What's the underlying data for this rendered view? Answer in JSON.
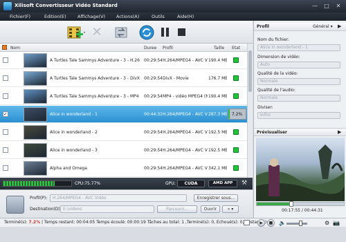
{
  "window": {
    "title": "Xilisoft Convertisseur Vidéo Standard"
  },
  "menu": [
    "Fichier(F)",
    "Edition(E)",
    "Affichage(V)",
    "Actions(A)",
    "Outils",
    "Aide(H)"
  ],
  "list": {
    "headers": {
      "name": "Nom",
      "duration": "Duree",
      "profile": "Profil",
      "size": "Taille",
      "state": "Etat"
    },
    "rows": [
      {
        "name": "A Turtles Tale Sammys Adventure - 3 - H.264...",
        "duration": "00:29:54",
        "profile": "H.264/MPEG4 - AVC Vidéo",
        "size": "190.4 MB",
        "checked": false,
        "selected": false,
        "thumb": "#6f9dc9"
      },
      {
        "name": "A Turtles Tale Sammys Adventure - 3 - DivX ...",
        "duration": "00:29:54",
        "profile": "DivX - Movie",
        "size": "176.7 MB",
        "checked": false,
        "selected": false,
        "thumb": "#79a9d2"
      },
      {
        "name": "A Turtles Tale Sammys Adventure - 3 - MP4 ...",
        "duration": "00:29:54",
        "profile": "MP4 - vidéo MPEG4 (N...",
        "size": "190.4 MB",
        "checked": false,
        "selected": false,
        "thumb": "#5f90bf"
      },
      {
        "name": "Alice in wonderland - 1",
        "duration": "00:44:31",
        "profile": "H.264/MPEG4 - AVC Vid...",
        "size": "287.3 MB",
        "checked": true,
        "selected": true,
        "progress": "7.2%",
        "progress_value": 0.072,
        "thumb": "#3b4d66"
      },
      {
        "name": "Alice in wonderland - 2",
        "duration": "00:29:54",
        "profile": "H.264/MPEG4 - AVC Vid...",
        "size": "192.5 MB",
        "checked": false,
        "selected": false,
        "thumb": "#4b4a3a"
      },
      {
        "name": "Alice in wonderland - 3",
        "duration": "00:29:54",
        "profile": "H.264/MPEG4 - AVC Vid...",
        "size": "192.5 MB",
        "checked": false,
        "selected": false,
        "thumb": "#3f4a3c"
      },
      {
        "name": "Alpha and Omega",
        "duration": "00:29:54",
        "profile": "H.264/MPEG4 - AVC Vid...",
        "size": "342.1 MB",
        "checked": false,
        "selected": false,
        "thumb": "#6b7f95"
      }
    ]
  },
  "cpu": {
    "label": "CPU:75.77%",
    "cpu_fraction": 0.7577,
    "gpu_label": "GPU:",
    "cuda_label": "CUDA",
    "amd_label": "AMD APP"
  },
  "output": {
    "profile_label": "Profil(P):",
    "profile_value": "H.264/MPEG4 - AVC Vidéo",
    "save_as_label": "Enregistrer sous...",
    "destination_label": "Destination(D):",
    "destination_value": "E:\\videos",
    "browse_label": "Parcourir...",
    "open_label": "Ouvrir"
  },
  "status": {
    "prefix": "Terminé(s): ",
    "percent": "7.2%",
    "rest": " | Temps restant: 00:04:05 Temps écoulé: 00:00:19 Tâches au total: 1 ,Terminé(s): 0, Echoué(s): 0, Restant(s): 1"
  },
  "side": {
    "profile_header": "Profil",
    "general_label": "Général",
    "filename_label": "Nom du fichier:",
    "filename_value": "Alice in wonderland - 1",
    "video_dim_label": "Dimension de vidéo:",
    "video_dim_value": "Auto",
    "video_quality_label": "Qualité de la vidéo:",
    "video_quality_value": "Normale",
    "audio_quality_label": "Qualité de l'audio:",
    "audio_quality_value": "Normale",
    "split_label": "Diviser:",
    "split_value": "Infini",
    "preview_header": "Prévisualiser",
    "time_current": "00:17:55",
    "time_total": "00:44:31",
    "time_fraction": 0.4
  }
}
